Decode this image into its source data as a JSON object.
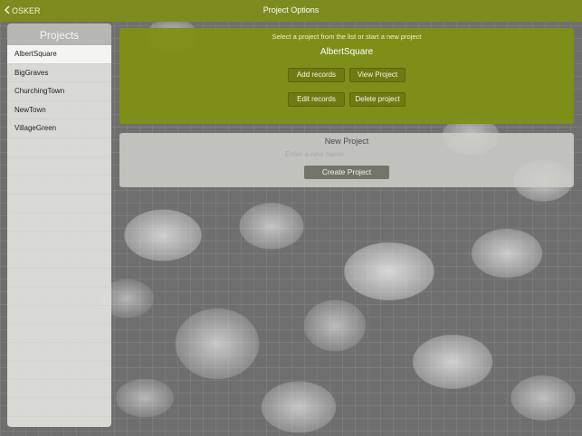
{
  "navbar": {
    "back_label": "OSKER",
    "title": "Project Options"
  },
  "sidebar": {
    "header": "Projects",
    "items": [
      {
        "label": "AlbertSquare",
        "selected": true
      },
      {
        "label": "BigGraves",
        "selected": false
      },
      {
        "label": "ChurchingTown",
        "selected": false
      },
      {
        "label": "NewTown",
        "selected": false
      },
      {
        "label": "VillageGreen",
        "selected": false
      }
    ]
  },
  "select_panel": {
    "hint": "Select a project from the list or start a new project",
    "current_project": "AlbertSquare",
    "add_records_label": "Add records",
    "view_project_label": "View Project",
    "edit_records_label": "Edit records",
    "delete_project_label": "Delete project"
  },
  "new_project": {
    "title": "New Project",
    "name_placeholder": "Enter a new name",
    "name_value": "",
    "create_label": "Create Project"
  },
  "colors": {
    "navbar": "#7e8b1f",
    "select_panel": "#808f16",
    "olive_button": "#6f7a12",
    "create_button": "#727569"
  },
  "icons": {
    "back": "chevron-left-icon"
  }
}
